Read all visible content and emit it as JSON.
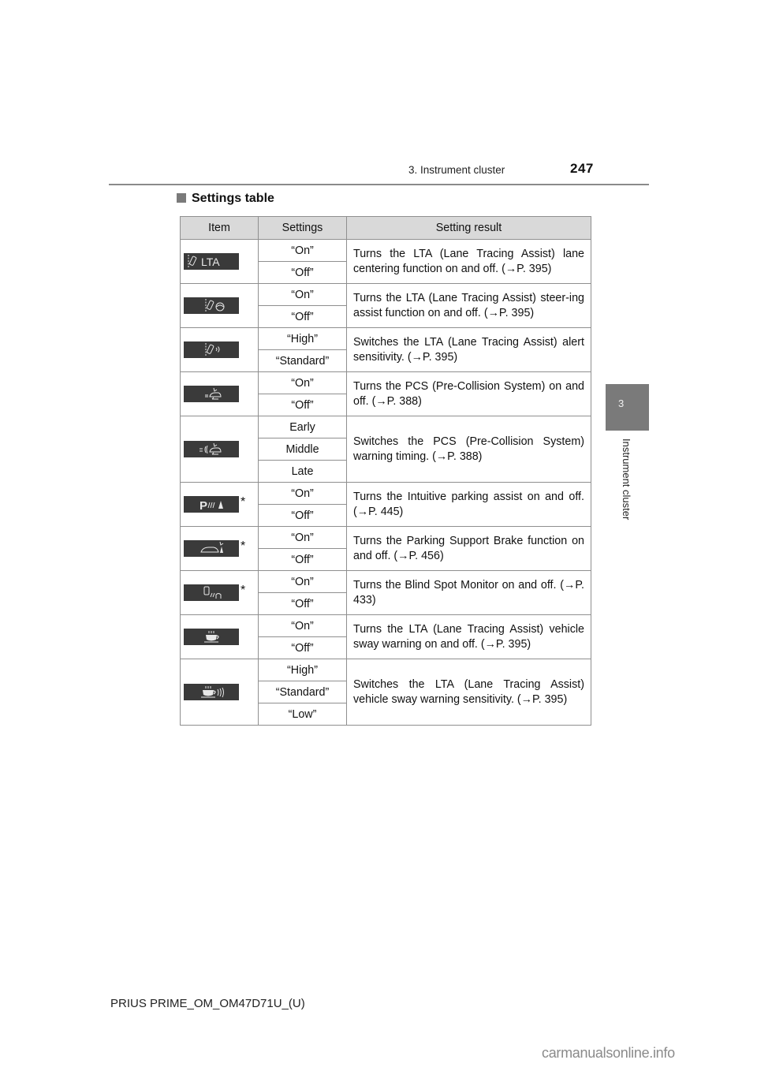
{
  "header": {
    "section": "3. Instrument cluster",
    "page_number": "247"
  },
  "side_tab": {
    "chapter_number": "3",
    "chapter_label": "Instrument cluster"
  },
  "section_title": "Settings table",
  "table": {
    "columns": [
      "Item",
      "Settings",
      "Setting result"
    ],
    "rows": [
      {
        "icon": "lta-lane-centering-icon",
        "icon_text": "LTA",
        "asterisk": false,
        "settings": [
          "“On”",
          "“Off”"
        ],
        "result": "Turns the LTA (Lane Tracing Assist) lane centering function on and off. (→P. 395)"
      },
      {
        "icon": "lta-steering-assist-icon",
        "icon_text": "",
        "asterisk": false,
        "settings": [
          "“On”",
          "“Off”"
        ],
        "result": "Turns the LTA (Lane Tracing Assist) steer-ing assist function on and off. (→P. 395)"
      },
      {
        "icon": "lta-alert-sensitivity-icon",
        "icon_text": "",
        "asterisk": false,
        "settings": [
          "“High”",
          "“Standard”"
        ],
        "result": "Switches the LTA (Lane Tracing Assist) alert sensitivity. (→P. 395)"
      },
      {
        "icon": "pcs-icon",
        "icon_text": "",
        "asterisk": false,
        "settings": [
          "“On”",
          "“Off”"
        ],
        "result": "Turns the PCS (Pre-Collision System) on and off. (→P. 388)"
      },
      {
        "icon": "pcs-warning-timing-icon",
        "icon_text": "",
        "asterisk": false,
        "settings": [
          "Early",
          "Middle",
          "Late"
        ],
        "result": "Switches the PCS (Pre-Collision System) warning timing. (→P. 388)"
      },
      {
        "icon": "intuitive-parking-assist-icon",
        "icon_text": "P",
        "asterisk": true,
        "settings": [
          "“On”",
          "“Off”"
        ],
        "result": "Turns the Intuitive parking assist on and off. (→P. 445)"
      },
      {
        "icon": "parking-support-brake-icon",
        "icon_text": "",
        "asterisk": true,
        "settings": [
          "“On”",
          "“Off”"
        ],
        "result": "Turns the Parking Support Brake function on and off. (→P. 456)"
      },
      {
        "icon": "blind-spot-monitor-icon",
        "icon_text": "",
        "asterisk": true,
        "settings": [
          "“On”",
          "“Off”"
        ],
        "result": "Turns the Blind Spot Monitor on and off. (→P. 433)"
      },
      {
        "icon": "vehicle-sway-warning-icon",
        "icon_text": "",
        "asterisk": false,
        "settings": [
          "“On”",
          "“Off”"
        ],
        "result": "Turns the LTA (Lane Tracing Assist) vehicle sway warning on and off. (→P. 395)"
      },
      {
        "icon": "vehicle-sway-sensitivity-icon",
        "icon_text": "",
        "asterisk": false,
        "settings": [
          "“High”",
          "“Standard”",
          "“Low”"
        ],
        "result": "Switches the LTA (Lane Tracing Assist) vehicle sway warning sensitivity. (→P. 395)"
      }
    ],
    "asterisk_symbol": "*"
  },
  "footer": {
    "document_code": "PRIUS PRIME_OM_OM47D71U_(U)",
    "watermark": "carmanualsonline.info"
  }
}
